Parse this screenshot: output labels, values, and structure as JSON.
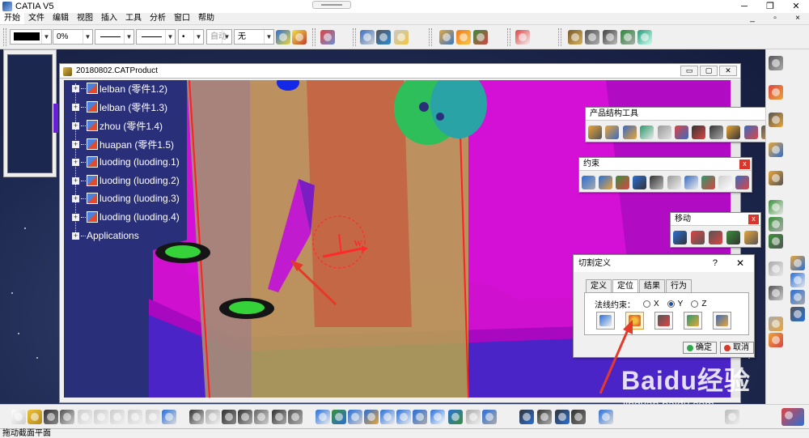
{
  "window": {
    "title": "CATIA V5",
    "min": "─",
    "restore": "❐",
    "close": "✕"
  },
  "menu": {
    "items": [
      "开始",
      "文件",
      "编辑",
      "视图",
      "插入",
      "工具",
      "分析",
      "窗口",
      "帮助"
    ],
    "active": "开始",
    "mdi_min": "_",
    "mdi_restore": "▫",
    "mdi_close": "×"
  },
  "toolbar": {
    "color_label": "",
    "transparency": "0%",
    "thickness": "",
    "linetype": "",
    "point": "•",
    "layer_auto": "自动",
    "layer": "无"
  },
  "document": {
    "title": "20180802.CATProduct",
    "min": "▭",
    "restore": "▢",
    "close": "✕"
  },
  "tree": {
    "items": [
      "lelban (零件1.2)",
      "lelban (零件1.3)",
      "zhou (零件1.4)",
      "huapan (零件1.5)",
      "luoding (luoding.1)",
      "luoding (luoding.2)",
      "luoding (luoding.3)",
      "luoding (luoding.4)",
      "Applications"
    ]
  },
  "float_toolbars": {
    "product_structure": {
      "title": "产品结构工具",
      "close": "x"
    },
    "constraints": {
      "title": "约束",
      "close": "x"
    },
    "move": {
      "title": "移动",
      "close": "x"
    }
  },
  "dialog": {
    "title": "切割定义",
    "help": "?",
    "close": "✕",
    "tabs": [
      "定义",
      "定位",
      "结果",
      "行为"
    ],
    "active_tab": "定位",
    "normal_constraint_label": "法线约束：",
    "axis_options": [
      "X",
      "Y",
      "Z"
    ],
    "selected_axis": "Y",
    "ok_label": "确定",
    "cancel_label": "取消"
  },
  "model": {
    "axis_label": "W"
  },
  "status": {
    "text": "拖动截面平面"
  },
  "watermark": {
    "text": "Baidu经验",
    "url": "jingyan.baidu.com"
  },
  "colors": {
    "magenta": "#e100e1",
    "purple": "#5a2fd0",
    "olive": "#b7a84a",
    "accent_red": "#e53a2a"
  }
}
